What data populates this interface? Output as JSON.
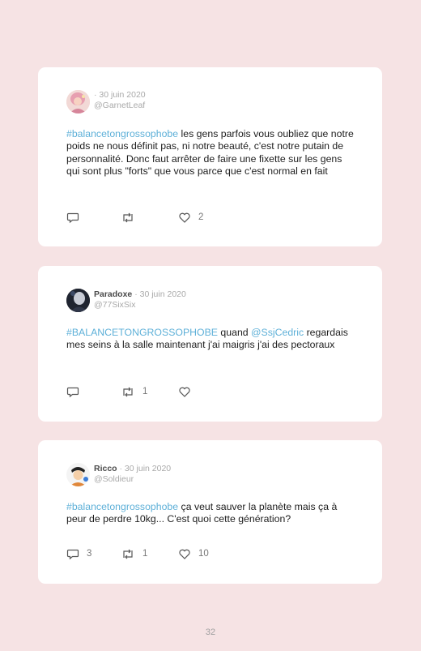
{
  "tweets": [
    {
      "name": "",
      "date": "· 30 juin 2020",
      "handle": "@GarnetLeaf",
      "hashtag": "#balancetongrossophobe",
      "text": " les gens parfois vous oubliez que notre poids ne nous définit pas, ni notre beauté, c'est notre putain de personnalité. Donc faut arrêter de faire une fixette sur les gens qui sont plus \"forts\" que vous parce que c'est normal en fait",
      "replies": "",
      "retweets": "",
      "likes": "2"
    },
    {
      "name": "Paradoxe",
      "date": "· 30 juin 2020",
      "handle": "@77SixSix",
      "hashtag": "#BALANCETONGROSSOPHOBE",
      "text_a": " quand ",
      "mention": "@SsjCedric",
      "text_b": " regardais mes seins à la salle maintenant j'ai maigris j'ai des pectoraux",
      "replies": "",
      "retweets": "1",
      "likes": ""
    },
    {
      "name": "Ricco",
      "date": "· 30 juin 2020",
      "handle": "@Soldieur",
      "hashtag": "#balancetongrossophobe",
      "text": " ça veut sauver la planète mais ça à peur de perdre 10kg... C'est quoi cette génération?",
      "replies": "3",
      "retweets": "1",
      "likes": "10"
    }
  ],
  "page_number": "32",
  "colors": {
    "background": "#f6e3e4",
    "card": "#ffffff",
    "link": "#5eb0d8",
    "icon": "#555555"
  }
}
